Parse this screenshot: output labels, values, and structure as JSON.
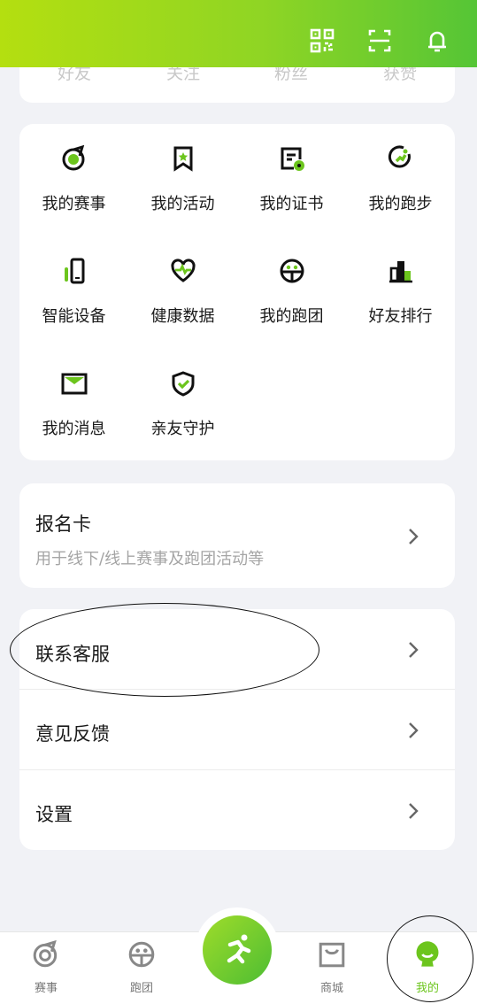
{
  "header": {
    "icons": [
      "qr-code-icon",
      "scan-icon",
      "bell-icon"
    ]
  },
  "stats": {
    "labels": [
      "好友",
      "关注",
      "粉丝",
      "获赞"
    ]
  },
  "grid": {
    "items": [
      {
        "label": "我的赛事",
        "icon": "event-icon"
      },
      {
        "label": "我的活动",
        "icon": "activity-icon"
      },
      {
        "label": "我的证书",
        "icon": "certificate-icon"
      },
      {
        "label": "我的跑步",
        "icon": "running-icon"
      },
      {
        "label": "智能设备",
        "icon": "device-icon"
      },
      {
        "label": "健康数据",
        "icon": "heart-icon"
      },
      {
        "label": "我的跑团",
        "icon": "group-icon"
      },
      {
        "label": "好友排行",
        "icon": "ranking-icon"
      },
      {
        "label": "我的消息",
        "icon": "message-icon"
      },
      {
        "label": "亲友守护",
        "icon": "shield-icon"
      }
    ]
  },
  "registration": {
    "title": "报名卡",
    "subtitle": "用于线下/线上赛事及跑团活动等"
  },
  "menu": {
    "items": [
      "联系客服",
      "意见反馈",
      "设置"
    ]
  },
  "tabbar": {
    "tabs": [
      {
        "label": "赛事",
        "icon": "event-icon"
      },
      {
        "label": "跑团",
        "icon": "group-icon"
      },
      {
        "label": "",
        "icon": "runner-icon"
      },
      {
        "label": "商城",
        "icon": "shop-icon"
      },
      {
        "label": "我的",
        "icon": "profile-icon"
      }
    ],
    "active_color": "#6cc51d"
  },
  "colors": {
    "accent": "#6cc51d",
    "header_gradient": [
      "#b4df10",
      "#55c536"
    ]
  }
}
